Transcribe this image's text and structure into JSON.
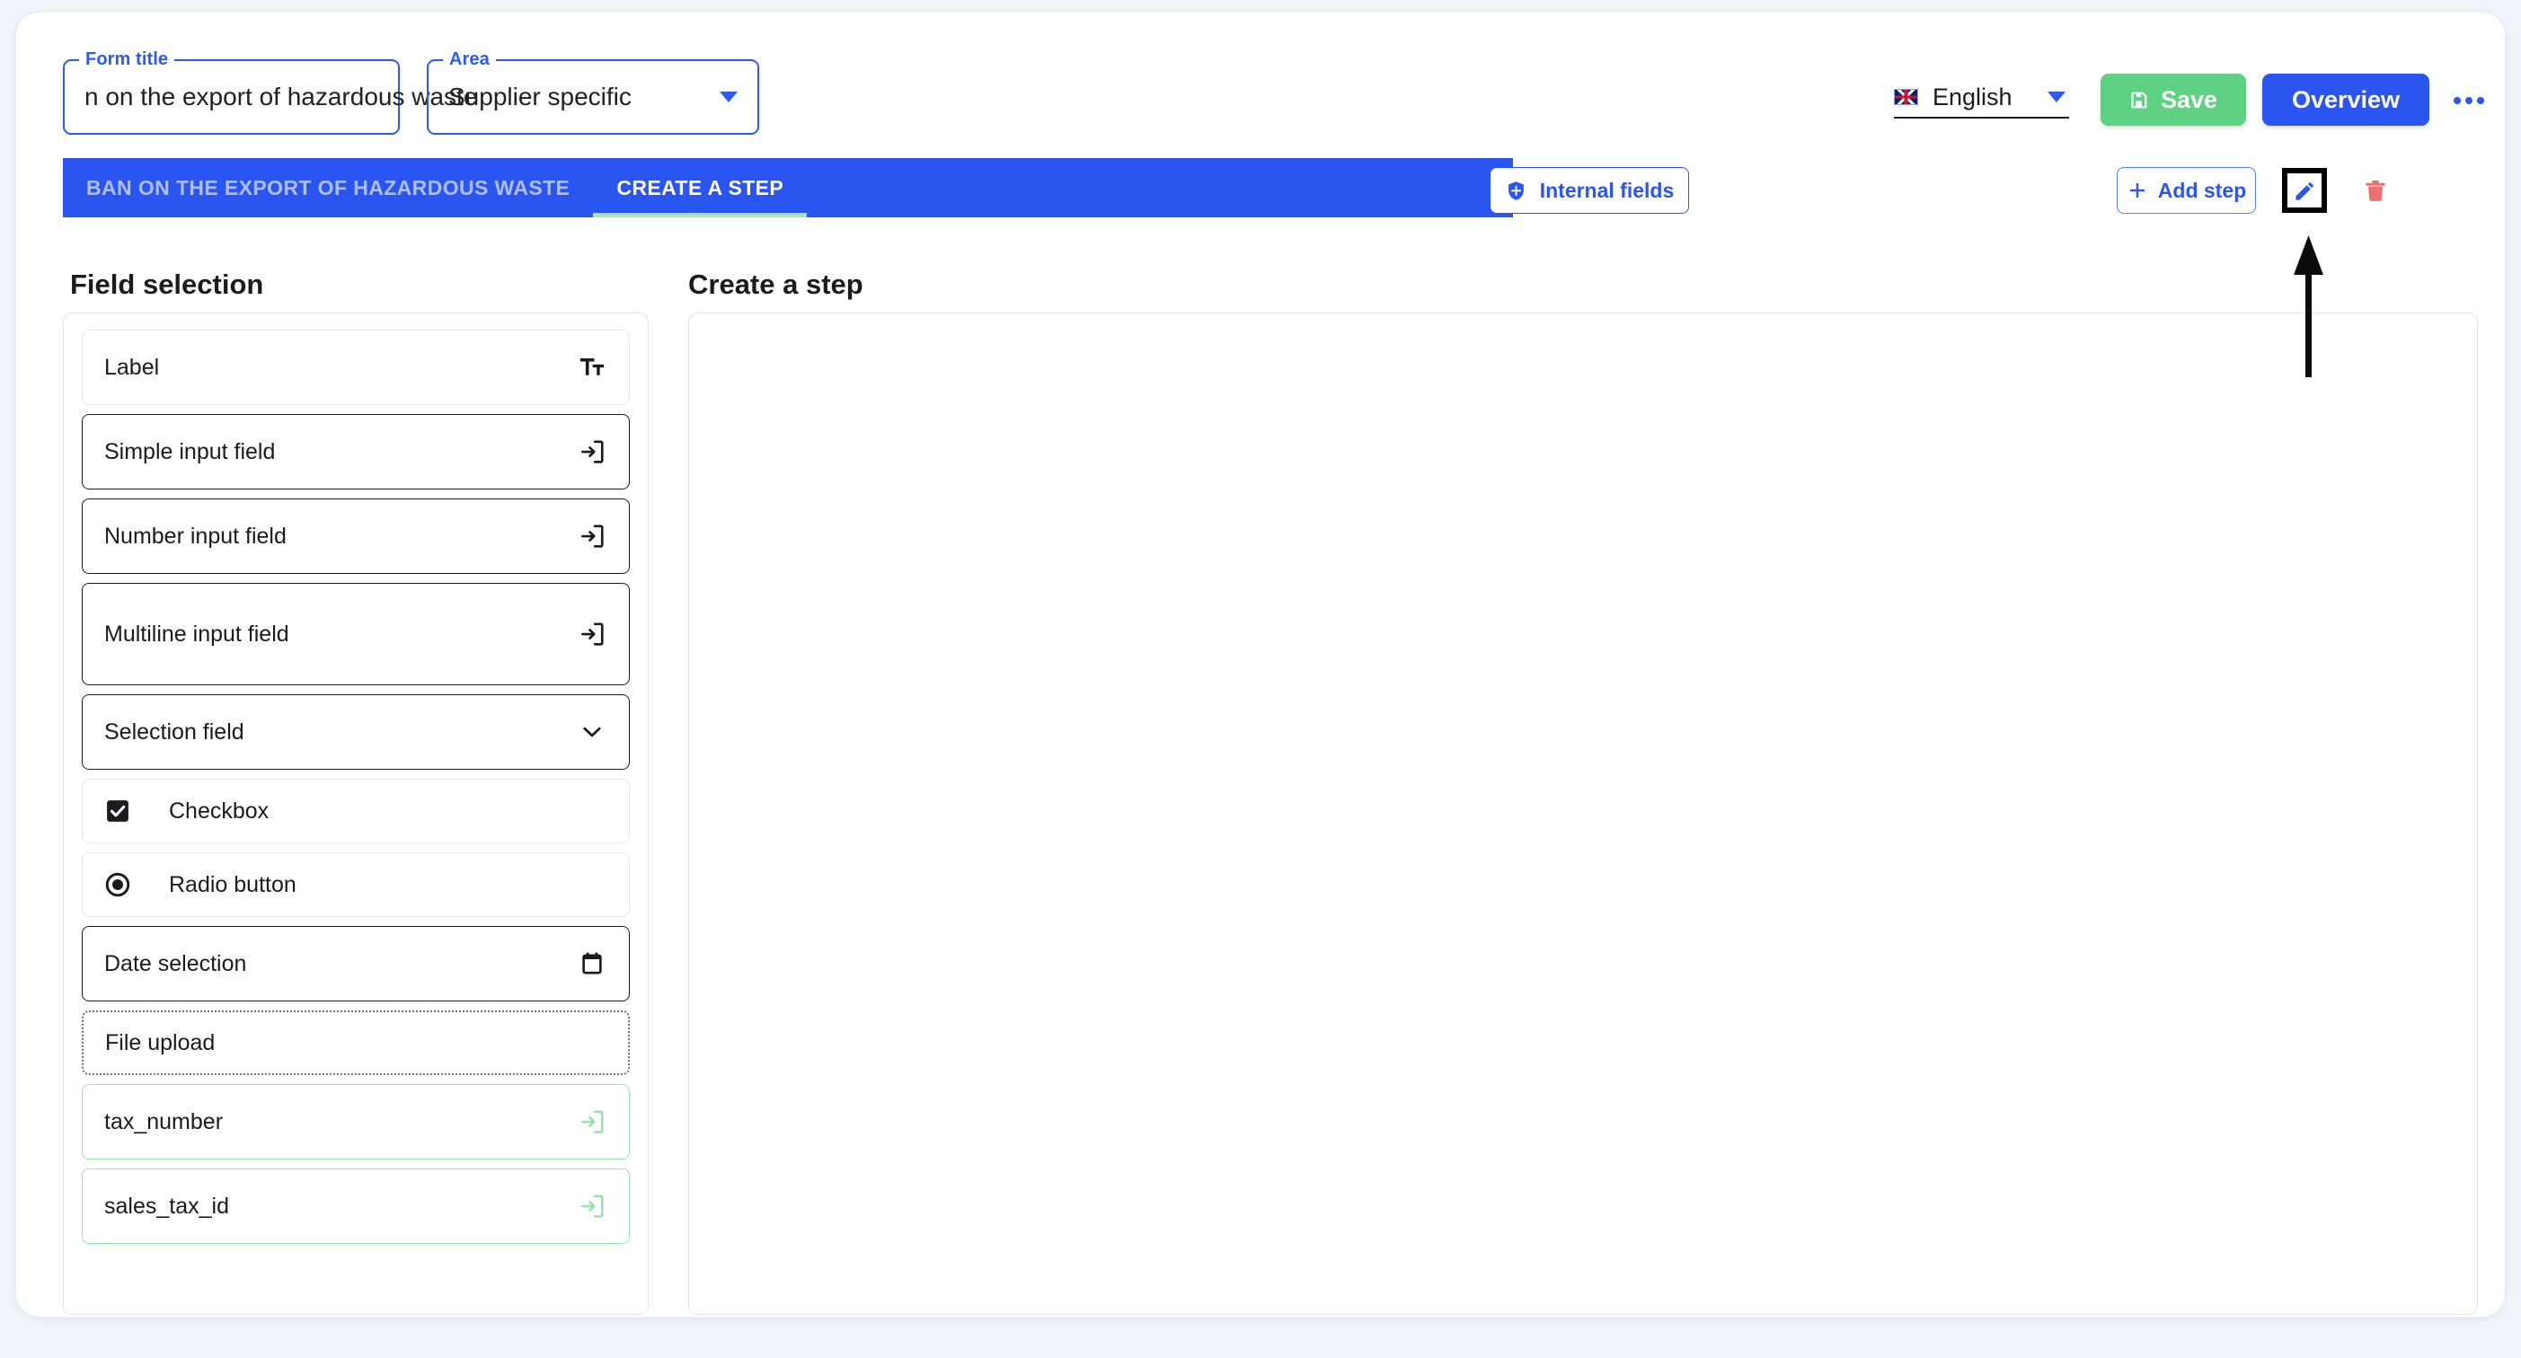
{
  "header": {
    "form_title_legend": "Form title",
    "form_title_value": "n on the export of hazardous waste",
    "area_legend": "Area",
    "area_value": "Supplier specific",
    "language_label": "English",
    "language_flag_icon": "uk-flag-icon",
    "save_label": "Save",
    "save_icon": "floppy-disk-icon",
    "overview_label": "Overview",
    "more_icon": "ellipsis-icon"
  },
  "tabs": [
    {
      "label": "BAN ON THE EXPORT OF HAZARDOUS WASTE",
      "active": false
    },
    {
      "label": "CREATE A STEP",
      "active": true
    }
  ],
  "toolbar": {
    "internal_fields_label": "Internal fields",
    "internal_fields_icon": "shield-icon",
    "add_step_label": "Add step",
    "add_step_icon": "plus-icon",
    "edit_step_icon": "pencil-icon",
    "delete_step_icon": "trash-icon"
  },
  "left_panel": {
    "title": "Field selection",
    "items": [
      {
        "label": "Label",
        "icon": "text-format-icon",
        "style": "light",
        "size": "medium",
        "lead": null
      },
      {
        "label": "Simple input field",
        "icon": "input-arrow-icon",
        "style": "dark",
        "size": "medium",
        "lead": null
      },
      {
        "label": "Number input field",
        "icon": "input-arrow-icon",
        "style": "dark",
        "size": "medium",
        "lead": null
      },
      {
        "label": "Multiline input field",
        "icon": "input-arrow-icon",
        "style": "dark",
        "size": "large",
        "lead": null
      },
      {
        "label": "Selection field",
        "icon": "chevron-down-icon",
        "style": "dark",
        "size": "medium",
        "lead": null
      },
      {
        "label": "Checkbox",
        "icon": null,
        "style": "light",
        "size": "small",
        "lead": "checkbox-checked-icon"
      },
      {
        "label": "Radio button",
        "icon": null,
        "style": "light",
        "size": "small",
        "lead": "radio-selected-icon"
      },
      {
        "label": "Date selection",
        "icon": "calendar-icon",
        "style": "dark",
        "size": "medium",
        "lead": null
      },
      {
        "label": "File upload",
        "icon": null,
        "style": "dotted",
        "size": "small",
        "lead": null
      },
      {
        "label": "tax_number",
        "icon": "input-arrow-icon",
        "style": "green",
        "size": "medium",
        "lead": null
      },
      {
        "label": "sales_tax_id",
        "icon": "input-arrow-icon",
        "style": "green",
        "size": "medium",
        "lead": null
      }
    ]
  },
  "right_panel": {
    "title": "Create a step"
  },
  "annotation": {
    "arrow_icon": "up-arrow-annotation",
    "points_to": "edit-step-button"
  },
  "colors": {
    "brand_blue": "#2b55f0",
    "save_green": "#5ed183",
    "tab_underline": "#a9e6b8",
    "delete_red": "#ef7070",
    "green_field_border": "#9de2ae",
    "page_bg": "#f1f3f9"
  }
}
